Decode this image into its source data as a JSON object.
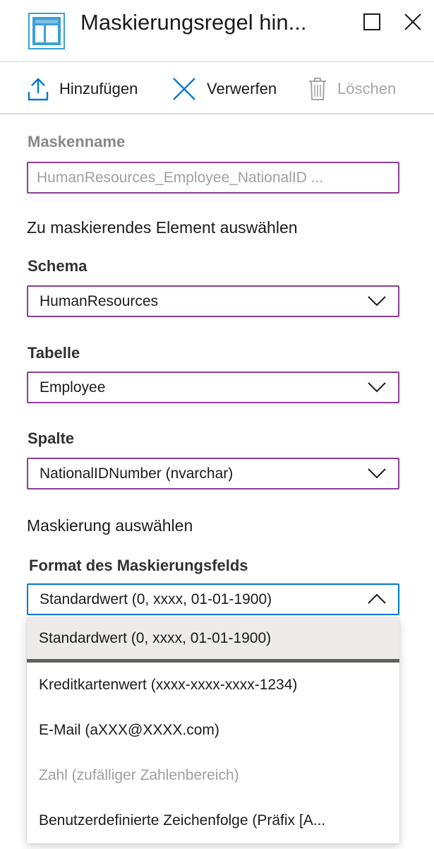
{
  "window": {
    "title": "Maskierungsregel hin...",
    "icon": "table-icon",
    "accent_color": "#3aa0d8"
  },
  "toolbar": {
    "add_label": "Hinzufügen",
    "discard_label": "Verwerfen",
    "delete_label": "Löschen"
  },
  "form": {
    "mask_name_label": "Maskenname",
    "mask_name_value": "HumanResources_Employee_NationalID   ...",
    "select_element_title": "Zu maskierendes Element auswählen",
    "schema_label": "Schema",
    "schema_value": "HumanResources",
    "table_label": "Tabelle",
    "table_value": "Employee",
    "column_label": "Spalte",
    "column_value": "NationalIDNumber (nvarchar)",
    "select_mask_title": "Maskierung auswählen",
    "format_label": "Format des Maskierungsfelds",
    "format_value": "Standardwert (0, xxxx, 01-01-1900)"
  },
  "format_options": [
    {
      "label": "Standardwert (0, xxxx, 01-01-1900)",
      "state": "selected"
    },
    {
      "label": "Kreditkartenwert (xxxx-xxxx-xxxx-1234)",
      "state": "normal"
    },
    {
      "label": "E-Mail (aXXX@XXXX.com)",
      "state": "normal"
    },
    {
      "label": "Zahl (zufälliger Zahlenbereich)",
      "state": "disabled"
    },
    {
      "label": "Benutzerdefinierte Zeichenfolge (Präfix [A...",
      "state": "normal"
    }
  ],
  "colors": {
    "field_border": "#8a3f94",
    "focus_border": "#0078d4",
    "icon_blue": "#0078d4"
  }
}
